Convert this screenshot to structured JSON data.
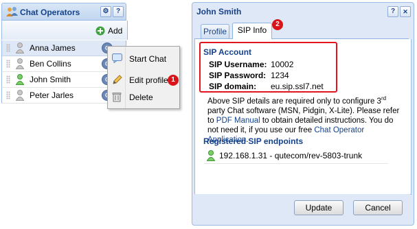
{
  "operators_panel": {
    "title": "Chat Operators",
    "header_buttons": [
      "gear-icon",
      "help-icon"
    ],
    "help_glyph": "?",
    "add_label": "Add",
    "operators": [
      {
        "name": "Anna James",
        "status": "offline",
        "selected": true
      },
      {
        "name": "Ben Collins",
        "status": "offline",
        "selected": false
      },
      {
        "name": "John Smith",
        "status": "online",
        "selected": false
      },
      {
        "name": "Peter Jarles",
        "status": "offline",
        "selected": false
      }
    ]
  },
  "context_menu": {
    "items": [
      {
        "label": "Start Chat",
        "icon": "chat-icon"
      },
      {
        "label": "Edit profile",
        "icon": "pencil-icon"
      },
      {
        "label": "Delete",
        "icon": "trash-icon"
      }
    ],
    "badge": "1"
  },
  "dialog": {
    "title": "John Smith",
    "help_glyph": "?",
    "close_glyph": "✕",
    "tabs": [
      {
        "label": "Profile",
        "active": false
      },
      {
        "label": "SIP Info",
        "active": true
      }
    ],
    "tab_badge": "2",
    "sip_account": {
      "heading": "SIP Account",
      "username_label": "SIP Username:",
      "username": "10002",
      "password_label": "SIP Password:",
      "password": "1234",
      "domain_label": "SIP domain:",
      "domain": "eu.sip.ssl7.net"
    },
    "info": {
      "part1": "Above SIP details are required only to configure 3",
      "sup": "rd",
      "part2": " party Chat software (MSN, Pidgin, X-Lite). Please refer to ",
      "link1": "PDF Manual",
      "part3": " to obtain detailed instructions. You do not need it, if you use our free ",
      "link2": "Chat Operator Application",
      "part4": "."
    },
    "endpoints_heading": "Registered SIP endpoints",
    "endpoints": [
      "192.168.1.31 - qutecom/rev-5803-trunk"
    ],
    "update_label": "Update",
    "cancel_label": "Cancel"
  },
  "colors": {
    "accent": "#15428b",
    "highlight_red": "#e2141e",
    "panel_bg": "#dfe8f6"
  }
}
